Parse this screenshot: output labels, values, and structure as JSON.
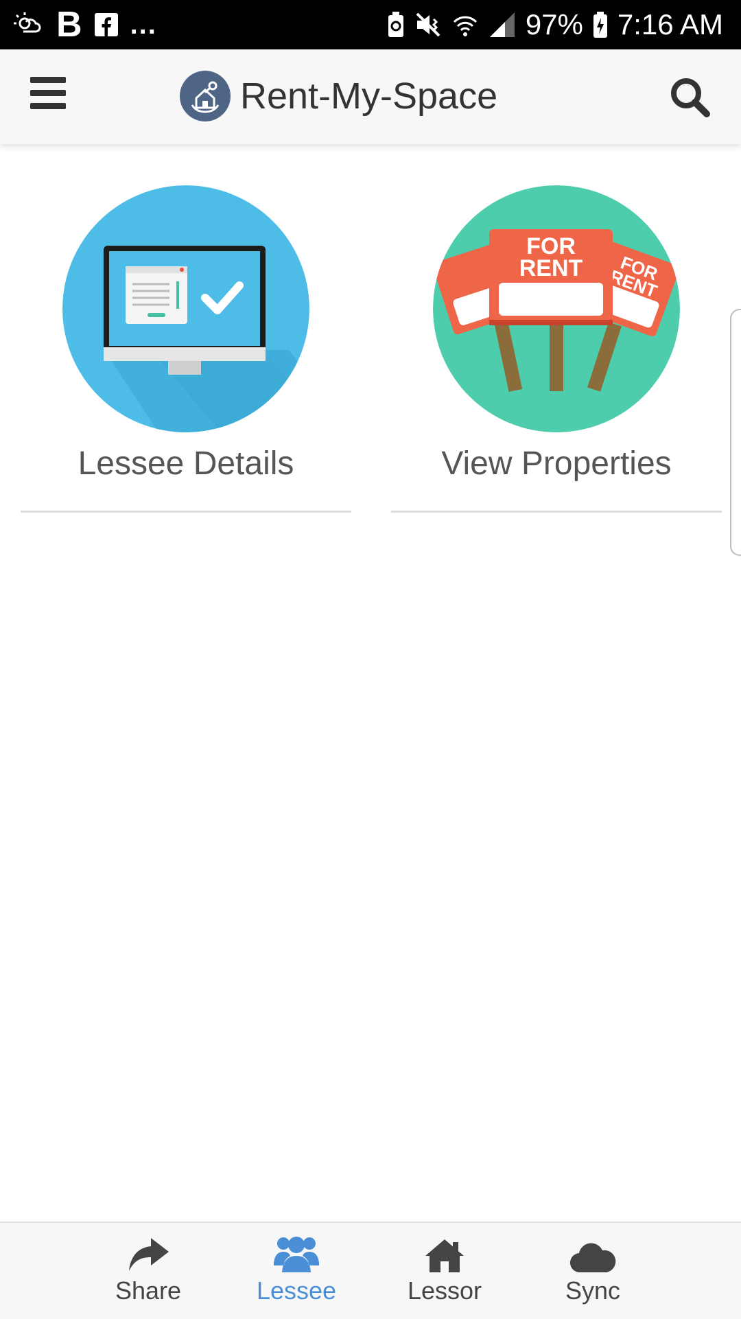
{
  "status_bar": {
    "left_letters": [
      "B",
      "f"
    ],
    "more": "...",
    "battery": "97%",
    "time": "7:16 AM"
  },
  "app_bar": {
    "title": "Rent-My-Space"
  },
  "tiles": [
    {
      "label": "Lessee Details",
      "icon": "monitor-check-icon",
      "bg": "#4dbde8"
    },
    {
      "label": "View Properties",
      "icon": "for-rent-signs-icon",
      "bg": "#4ecdac",
      "sign_text_top": "FOR",
      "sign_text_bottom": "RENT"
    }
  ],
  "bottom_nav": {
    "items": [
      {
        "label": "Share",
        "icon": "share-icon"
      },
      {
        "label": "Lessee",
        "icon": "users-icon",
        "active": true
      },
      {
        "label": "Lessor",
        "icon": "home-icon"
      },
      {
        "label": "Sync",
        "icon": "cloud-icon"
      }
    ]
  },
  "colors": {
    "accent": "#4a8fd6",
    "appbar_bg": "#f7f7f7",
    "text_dark": "#333333"
  }
}
